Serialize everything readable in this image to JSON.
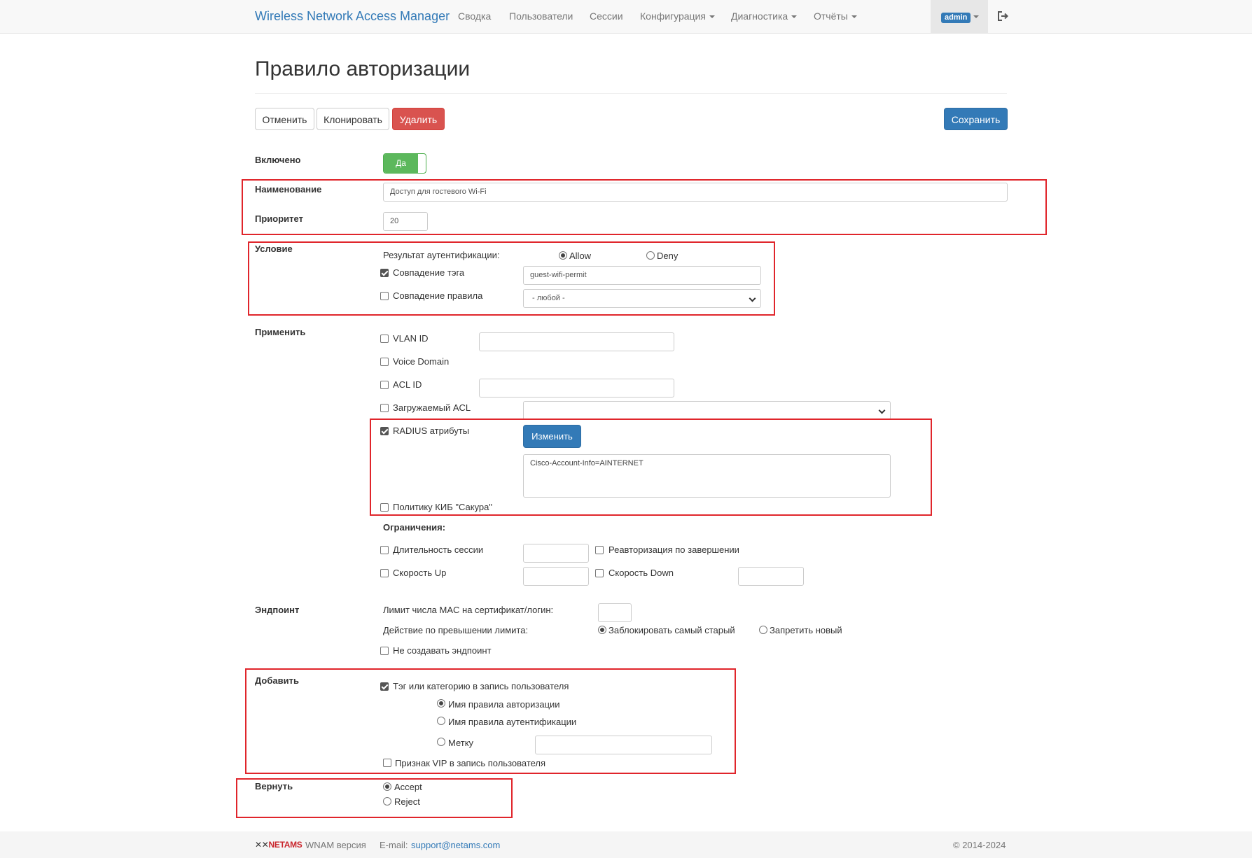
{
  "app": {
    "brand": "Wireless Network Access Manager",
    "nav": {
      "summary": "Сводка",
      "users": "Пользователи",
      "sessions": "Сессии",
      "config": "Конфигурация",
      "diagnostics": "Диагностика",
      "reports": "Отчёты"
    },
    "user": "admin"
  },
  "page": {
    "title": "Правило авторизации",
    "buttons": {
      "cancel": "Отменить",
      "clone": "Клонировать",
      "delete": "Удалить",
      "save": "Сохранить"
    }
  },
  "form": {
    "enabled": {
      "label": "Включено",
      "value": "Да"
    },
    "name": {
      "label": "Наименование",
      "value": "Доступ для гостевого Wi-Fi"
    },
    "priority": {
      "label": "Приоритет",
      "value": "20"
    },
    "condition": {
      "label": "Условие",
      "auth_result_label": "Результат аутентификации:",
      "allow": "Allow",
      "deny": "Deny",
      "tag_match": "Совпадение тэга",
      "tag_value": "guest-wifi-permit",
      "rule_match": "Совпадение правила",
      "rule_value": "- любой -"
    },
    "apply": {
      "label": "Применить",
      "vlan_id": "VLAN ID",
      "voice_domain": "Voice Domain",
      "acl_id": "ACL ID",
      "downloadable_acl": "Загружаемый ACL",
      "radius_attrs": "RADIUS атрибуты",
      "edit_button": "Изменить",
      "radius_value": "Cisco-Account-Info=AINTERNET",
      "sakura_policy": "Политику КИБ \"Сакура\""
    },
    "limits": {
      "label": "Ограничения:",
      "session_duration": "Длительность сессии",
      "reauth": "Реавторизация по завершении",
      "speed_up": "Скорость Up",
      "speed_down": "Скорость Down"
    },
    "endpoint": {
      "label": "Эндпоинт",
      "mac_limit": "Лимит числа MAC на сертификат/логин:",
      "limit_action": "Действие по превышении лимита:",
      "block_oldest": "Заблокировать самый старый",
      "deny_new": "Запретить новый",
      "no_create": "Не создавать эндпоинт"
    },
    "add": {
      "label": "Добавить",
      "tag_or_category": "Тэг или категорию в запись пользователя",
      "authz_rule_name": "Имя правила авторизации",
      "authn_rule_name": "Имя правила аутентификации",
      "mark": "Метку",
      "vip": "Признак VIP в запись пользователя"
    },
    "return": {
      "label": "Вернуть",
      "accept": "Accept",
      "reject": "Reject"
    }
  },
  "footer": {
    "logo": "NETAMS",
    "version": "WNAM версия",
    "email_label": "E-mail:",
    "email": "support@netams.com",
    "copyright": "© 2014-2024"
  }
}
